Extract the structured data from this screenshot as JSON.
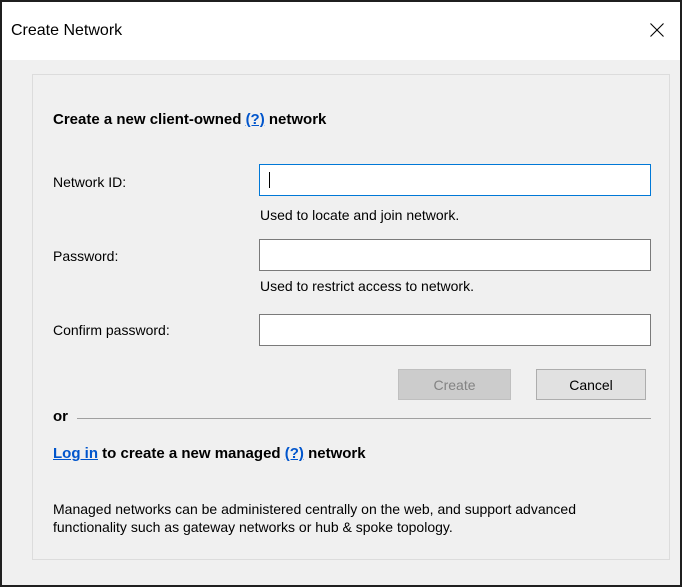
{
  "window": {
    "title": "Create Network",
    "close_icon": "close-icon"
  },
  "client_owned": {
    "heading_prefix": "Create a new client-owned",
    "help_link": "(?)",
    "heading_suffix": "network"
  },
  "fields": {
    "network_id": {
      "label": "Network ID:",
      "value": "",
      "hint": "Used to locate and join network."
    },
    "password": {
      "label": "Password:",
      "value": "",
      "hint": "Used to restrict access to network."
    },
    "confirm_password": {
      "label": "Confirm password:",
      "value": ""
    }
  },
  "buttons": {
    "create": "Create",
    "create_enabled": false,
    "cancel": "Cancel"
  },
  "separator": {
    "label": "or"
  },
  "managed": {
    "login_link": "Log in",
    "heading_middle": "to create a new managed",
    "help_link": "(?)",
    "heading_suffix": "network",
    "description": "Managed networks can be administered centrally on the web, and support advanced functionality such as gateway networks or hub & spoke topology."
  },
  "colors": {
    "link": "#0055cc",
    "focus_border": "#0078d7",
    "disabled_button": "#cccccc",
    "content_background": "#f0f0f0"
  }
}
